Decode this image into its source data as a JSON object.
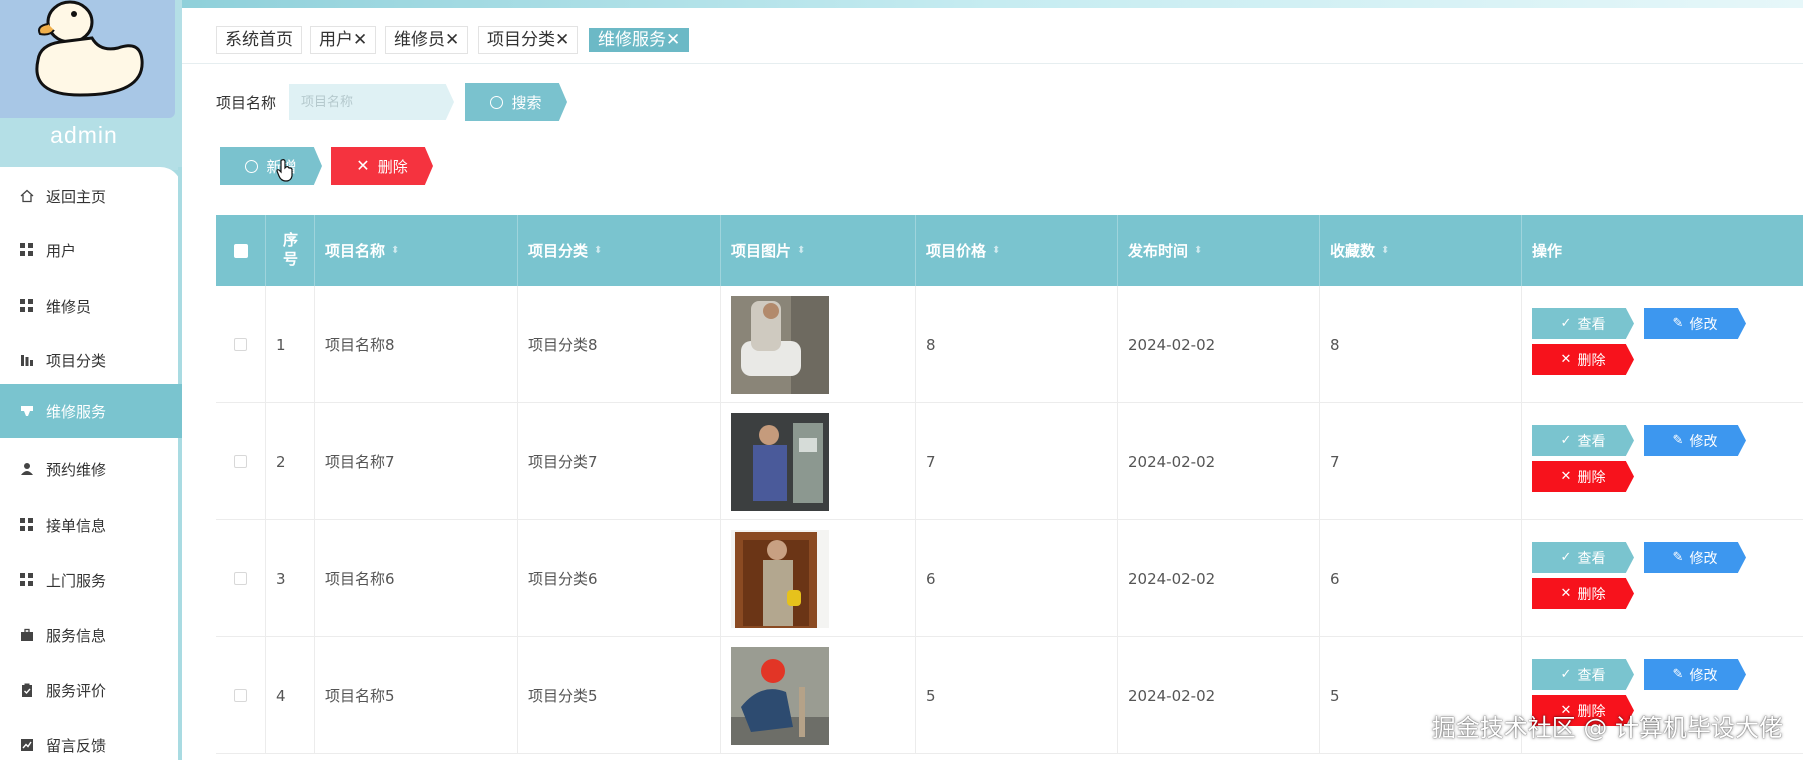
{
  "sidebar": {
    "username": "admin",
    "items": [
      {
        "label": "返回主页",
        "icon": "home-icon"
      },
      {
        "label": "用户",
        "icon": "grid-icon"
      },
      {
        "label": "维修员",
        "icon": "grid-icon"
      },
      {
        "label": "项目分类",
        "icon": "chart-icon"
      },
      {
        "label": "维修服务",
        "icon": "cup-icon",
        "active": true
      },
      {
        "label": "预约维修",
        "icon": "person-icon"
      },
      {
        "label": "接单信息",
        "icon": "grid-icon"
      },
      {
        "label": "上门服务",
        "icon": "grid-icon"
      },
      {
        "label": "服务信息",
        "icon": "briefcase-icon"
      },
      {
        "label": "服务评价",
        "icon": "clipboard-icon"
      },
      {
        "label": "留言反馈",
        "icon": "chart-icon"
      }
    ]
  },
  "tabs": [
    {
      "label": "系统首页",
      "closable": false
    },
    {
      "label": "用户",
      "closable": true
    },
    {
      "label": "维修员",
      "closable": true
    },
    {
      "label": "项目分类",
      "closable": true
    },
    {
      "label": "维修服务",
      "closable": true,
      "active": true
    }
  ],
  "close_glyph": "✕",
  "search": {
    "label": "项目名称",
    "placeholder": "项目名称",
    "value": "",
    "button_label": "搜索"
  },
  "toolbar": {
    "add_label": "新增",
    "delete_label": "删除"
  },
  "table": {
    "columns": [
      "序号",
      "项目名称",
      "项目分类",
      "项目图片",
      "项目价格",
      "发布时间",
      "收藏数",
      "操作"
    ],
    "rows": [
      {
        "seq": "1",
        "name": "项目名称8",
        "category": "项目分类8",
        "price": "8",
        "date": "2024-02-02",
        "favorites": "8"
      },
      {
        "seq": "2",
        "name": "项目名称7",
        "category": "项目分类7",
        "price": "7",
        "date": "2024-02-02",
        "favorites": "7"
      },
      {
        "seq": "3",
        "name": "项目名称6",
        "category": "项目分类6",
        "price": "6",
        "date": "2024-02-02",
        "favorites": "6"
      },
      {
        "seq": "4",
        "name": "项目名称5",
        "category": "项目分类5",
        "price": "5",
        "date": "2024-02-02",
        "favorites": "5"
      }
    ],
    "actions": {
      "view": "查看",
      "edit": "修改",
      "delete": "删除"
    }
  },
  "watermark": "掘金技术社区 @ 计算机毕设大佬",
  "colors": {
    "accent": "#7ac4cf",
    "edit": "#3d97ef",
    "danger": "#f5333f"
  }
}
